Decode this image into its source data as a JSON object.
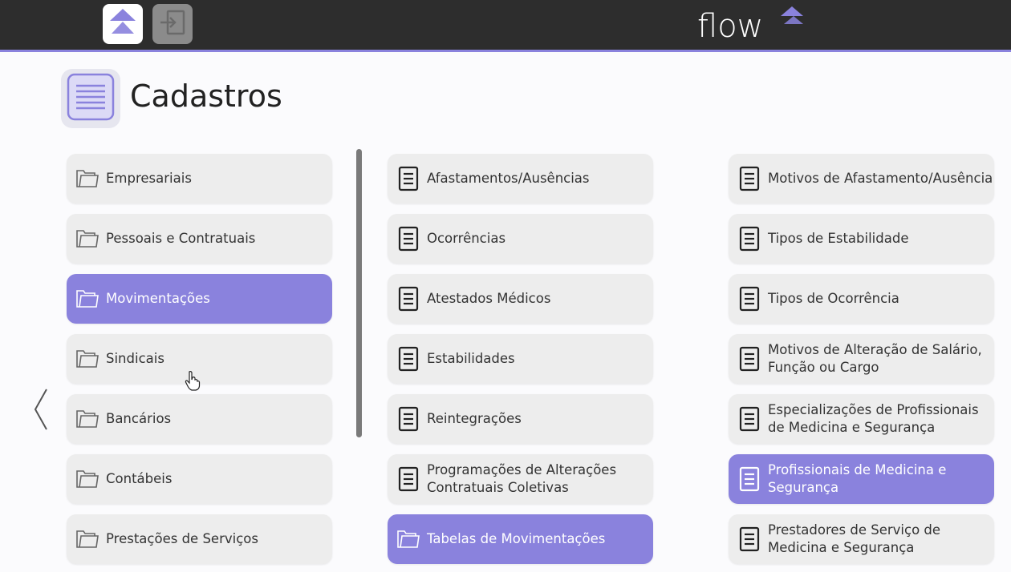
{
  "topbar": {
    "home_icon": "flow-logo-icon",
    "exit_icon": "sign-in-icon",
    "brand": "flow",
    "colors": {
      "bar": "#2d2d2d",
      "accent": "#8a82dd"
    }
  },
  "page": {
    "title": "Cadastros",
    "icon": "document-list-icon"
  },
  "column1": [
    {
      "label": "Empresariais",
      "icon": "folder-icon",
      "active": false
    },
    {
      "label": "Pessoais e Contratuais",
      "icon": "folder-icon",
      "active": false
    },
    {
      "label": "Movimentações",
      "icon": "folder-icon",
      "active": true
    },
    {
      "label": "Sindicais",
      "icon": "folder-icon",
      "active": false
    },
    {
      "label": "Bancários",
      "icon": "folder-icon",
      "active": false
    },
    {
      "label": "Contábeis",
      "icon": "folder-icon",
      "active": false
    },
    {
      "label": "Prestações de Serviços",
      "icon": "folder-icon",
      "active": false
    }
  ],
  "column2": [
    {
      "label": "Afastamentos/Ausências",
      "icon": "document-icon",
      "active": false
    },
    {
      "label": "Ocorrências",
      "icon": "document-icon",
      "active": false
    },
    {
      "label": "Atestados Médicos",
      "icon": "document-icon",
      "active": false
    },
    {
      "label": "Estabilidades",
      "icon": "document-icon",
      "active": false
    },
    {
      "label": "Reintegrações",
      "icon": "document-icon",
      "active": false
    },
    {
      "label": "Programações de Alterações Contratuais Coletivas",
      "icon": "document-icon",
      "active": false
    },
    {
      "label": "Tabelas de Movimentações",
      "icon": "folder-icon",
      "active": true
    }
  ],
  "column3": [
    {
      "label": "Motivos de Afastamento/Ausência",
      "icon": "document-icon",
      "active": false
    },
    {
      "label": "Tipos de Estabilidade",
      "icon": "document-icon",
      "active": false
    },
    {
      "label": "Tipos de Ocorrência",
      "icon": "document-icon",
      "active": false
    },
    {
      "label": "Motivos de Alteração de Salário, Função ou Cargo",
      "icon": "document-icon",
      "active": false
    },
    {
      "label": "Especializações de Profissionais de Medicina e Segurança",
      "icon": "document-icon",
      "active": false
    },
    {
      "label": "Profissionais de Medicina e Segurança",
      "icon": "document-icon",
      "active": true
    },
    {
      "label": "Prestadores de Serviço de Medicina e Segurança",
      "icon": "document-icon",
      "active": false
    }
  ],
  "nav": {
    "back_icon": "chevron-left-icon"
  }
}
